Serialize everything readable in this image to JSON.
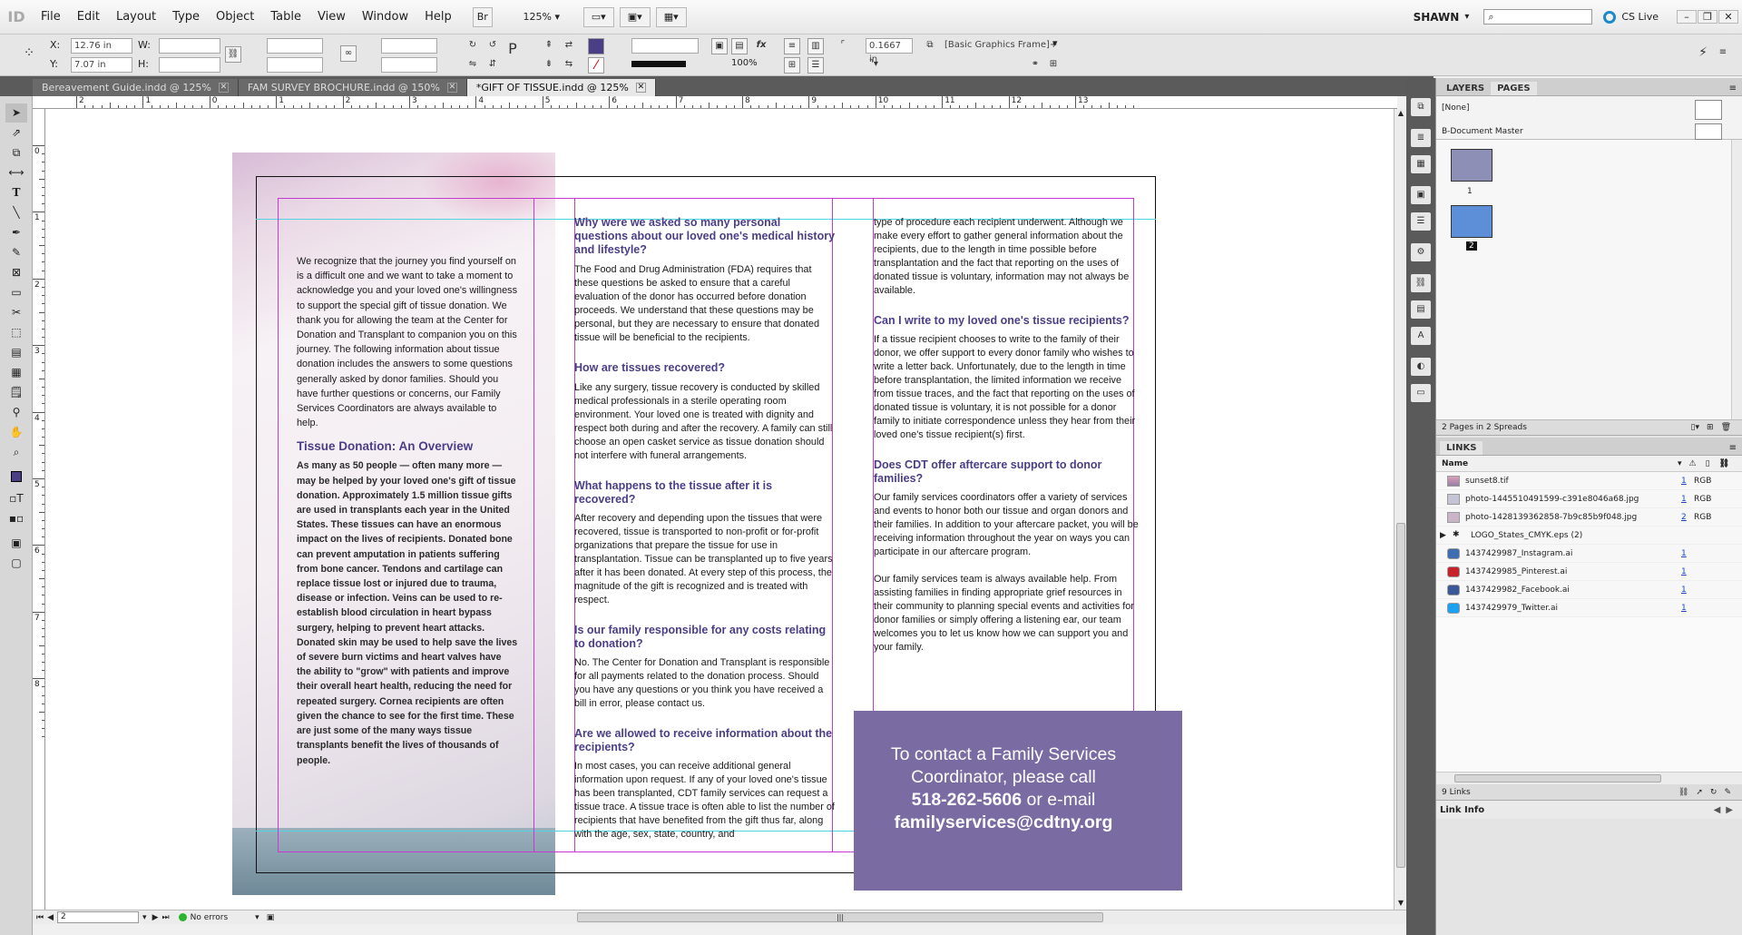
{
  "app": {
    "logo": "ID",
    "user": "SHAWN",
    "cs_live": "CS Live",
    "zoom": "125%"
  },
  "menu": [
    "File",
    "Edit",
    "Layout",
    "Type",
    "Object",
    "Table",
    "View",
    "Window",
    "Help"
  ],
  "bridge_label": "Br",
  "control": {
    "x": "12.76 in",
    "y": "7.07 in",
    "w": "",
    "h": "",
    "stroke_weight": "0.1667 in",
    "opacity": "100%",
    "style": "[Basic Graphics Frame]+"
  },
  "tabs": [
    {
      "label": "Bereavement Guide.indd @ 125%"
    },
    {
      "label": "FAM SURVEY BROCHURE.indd @ 150%"
    },
    {
      "label": "*GIFT OF TISSUE.indd @ 125%"
    }
  ],
  "ruler": {
    "h_labels": [
      "2",
      "1",
      "0",
      "1",
      "2",
      "3",
      "4",
      "5",
      "6",
      "7",
      "8",
      "9",
      "10",
      "11",
      "12",
      "13"
    ],
    "v_labels": [
      "0",
      "1",
      "2",
      "3",
      "4",
      "5",
      "6",
      "7",
      "8"
    ]
  },
  "status": {
    "page": "2",
    "errors": "No errors"
  },
  "panels": {
    "pages": {
      "tabs": [
        "LAYERS",
        "PAGES"
      ],
      "none": "[None]",
      "master": "B-Document Master",
      "page1": "1",
      "page2": "2",
      "summary": "2 Pages in 2 Spreads"
    },
    "links": {
      "title": "LINKS",
      "col_name": "Name",
      "items": [
        {
          "name": "sunset8.tif",
          "page": "1",
          "cs": "RGB"
        },
        {
          "name": "photo-1445510491599-c391e8046a68.jpg",
          "page": "1",
          "cs": "RGB"
        },
        {
          "name": "photo-1428139362858-7b9c85b9f048.jpg",
          "page": "2",
          "cs": "RGB"
        },
        {
          "name": "LOGO_States_CMYK.eps (2)",
          "page": "",
          "cs": ""
        },
        {
          "name": "1437429987_Instagram.ai",
          "page": "1",
          "cs": ""
        },
        {
          "name": "1437429985_Pinterest.ai",
          "page": "1",
          "cs": ""
        },
        {
          "name": "1437429982_Facebook.ai",
          "page": "1",
          "cs": ""
        },
        {
          "name": "1437429979_Twitter.ai",
          "page": "1",
          "cs": ""
        }
      ],
      "count": "9 Links",
      "info": "Link Info"
    }
  },
  "doc": {
    "intro": "We recognize that the journey you find yourself on is a difficult one and we want to take a moment to acknowledge you and your loved one's willingness to support the special gift of tissue donation.  We thank you for allowing the team at the Center for Donation and Transplant to companion you on this journey. The following information about tissue donation includes the answers to some questions generally asked by donor families.  Should you have further questions or concerns, our Family Services Coordinators are always available to help.",
    "overview_title": "Tissue Donation: An Overview",
    "overview_body": "As many as 50 people — often many more — may be helped by your loved one's gift of tissue donation. Approximately 1.5 million tissue gifts are used in transplants each year in the United States. These tissues can have an enormous impact on the lives of recipients. Donated bone can prevent amputation in patients suffering from bone cancer. Tendons and cartilage can replace tissue lost or injured due to trauma, disease or infection. Veins can be used to re-establish blood circulation in heart bypass surgery, helping to prevent heart attacks. Donated skin may be used to help save the lives of severe burn victims and heart valves have the ability to \"grow\" with patients and improve their overall heart health, reducing the need for repeated surgery. Cornea recipients are often given the chance to see for the first time. These are just some of the many ways tissue transplants benefit the lives of thousands of people.",
    "q1": "Why were we asked so many personal questions about our loved one's medical history and lifestyle?",
    "a1": "The Food and Drug Administration (FDA) requires that these questions be asked to ensure that a careful evaluation of the donor has occurred before donation proceeds. We understand that these questions may be personal, but they are necessary to ensure that donated tissue will be beneficial to the recipients.",
    "q2": "How are tissues recovered?",
    "a2": "Like any surgery, tissue recovery is conducted by skilled medical professionals in a sterile operating room environment. Your loved one is treated with dignity and respect both during and after the recovery. A family can still choose an open casket service as tissue donation should not interfere with funeral arrangements.",
    "q3": "What happens to the tissue after it is recovered?",
    "a3": "After recovery and depending upon the tissues that were recovered, tissue is transported to non-profit or for-profit organizations that prepare the tissue for use in transplantation. Tissue can be transplanted up to five years after it has been donated. At every step of this process, the magnitude of the gift is recognized and is treated with respect.",
    "q4": "Is our family responsible for any costs relating to donation?",
    "a4": "No. The Center for Donation and Transplant is responsible for all payments related to the donation process. Should you have any questions or you think you have received a bill in error, please contact us.",
    "q5": "Are we allowed to receive information about the recipients?",
    "a5": "In most cases, you can receive additional general information upon request.  If any of your loved one's tissue has been transplanted, CDT family services can request a tissue trace. A tissue trace is often able to list the number of recipients that have benefited from the gift thus far, along with the age, sex, state, country, and",
    "a5b": "type of procedure each recipient underwent. Although we make every effort to gather general information about the recipients, due to the length in time possible before transplantation and the fact that reporting on the uses of donated tissue is voluntary, information may not always be available.",
    "q6": "Can I write to my loved one's tissue recipients?",
    "a6": "If a tissue recipient chooses to write to the family of their donor, we offer support to every donor family who wishes to write a letter back.  Unfortunately, due to the length in time before transplantation, the limited information we receive from tissue traces, and the fact that reporting on the uses of donated tissue is voluntary, it is not possible for a donor family to initiate correspondence unless they hear from their loved one's tissue recipient(s) first.",
    "q7": "Does CDT offer aftercare support to donor families?",
    "a7": "Our family services coordinators offer a variety of services and events to honor both our tissue and organ donors and their families. In addition to your aftercare packet, you will be receiving information throughout the year on ways you can participate in our aftercare program.",
    "a8": "Our family services team is always available help.  From assisting families in finding appropriate grief resources in their community to planning special events and activities for donor families or simply offering a listening ear, our team welcomes you to let us know how we can support you and your family.",
    "contact_l1": "To contact a Family Services",
    "contact_l2": "Coordinator, please call",
    "contact_phone": "518-262-5606",
    "contact_or": " or e-mail",
    "contact_email": "familyservices@cdtny.org"
  }
}
